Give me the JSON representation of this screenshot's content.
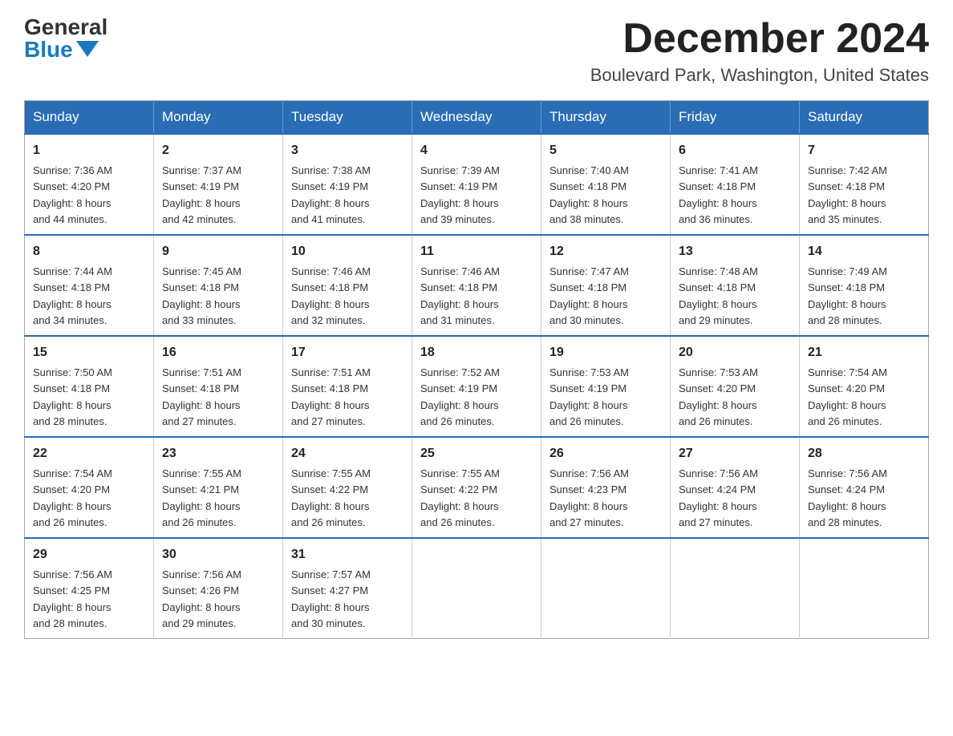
{
  "logo": {
    "general": "General",
    "blue": "Blue"
  },
  "title": "December 2024",
  "subtitle": "Boulevard Park, Washington, United States",
  "days_of_week": [
    "Sunday",
    "Monday",
    "Tuesday",
    "Wednesday",
    "Thursday",
    "Friday",
    "Saturday"
  ],
  "weeks": [
    [
      {
        "day": "1",
        "sunrise": "7:36 AM",
        "sunset": "4:20 PM",
        "daylight": "8 hours and 44 minutes."
      },
      {
        "day": "2",
        "sunrise": "7:37 AM",
        "sunset": "4:19 PM",
        "daylight": "8 hours and 42 minutes."
      },
      {
        "day": "3",
        "sunrise": "7:38 AM",
        "sunset": "4:19 PM",
        "daylight": "8 hours and 41 minutes."
      },
      {
        "day": "4",
        "sunrise": "7:39 AM",
        "sunset": "4:19 PM",
        "daylight": "8 hours and 39 minutes."
      },
      {
        "day": "5",
        "sunrise": "7:40 AM",
        "sunset": "4:18 PM",
        "daylight": "8 hours and 38 minutes."
      },
      {
        "day": "6",
        "sunrise": "7:41 AM",
        "sunset": "4:18 PM",
        "daylight": "8 hours and 36 minutes."
      },
      {
        "day": "7",
        "sunrise": "7:42 AM",
        "sunset": "4:18 PM",
        "daylight": "8 hours and 35 minutes."
      }
    ],
    [
      {
        "day": "8",
        "sunrise": "7:44 AM",
        "sunset": "4:18 PM",
        "daylight": "8 hours and 34 minutes."
      },
      {
        "day": "9",
        "sunrise": "7:45 AM",
        "sunset": "4:18 PM",
        "daylight": "8 hours and 33 minutes."
      },
      {
        "day": "10",
        "sunrise": "7:46 AM",
        "sunset": "4:18 PM",
        "daylight": "8 hours and 32 minutes."
      },
      {
        "day": "11",
        "sunrise": "7:46 AM",
        "sunset": "4:18 PM",
        "daylight": "8 hours and 31 minutes."
      },
      {
        "day": "12",
        "sunrise": "7:47 AM",
        "sunset": "4:18 PM",
        "daylight": "8 hours and 30 minutes."
      },
      {
        "day": "13",
        "sunrise": "7:48 AM",
        "sunset": "4:18 PM",
        "daylight": "8 hours and 29 minutes."
      },
      {
        "day": "14",
        "sunrise": "7:49 AM",
        "sunset": "4:18 PM",
        "daylight": "8 hours and 28 minutes."
      }
    ],
    [
      {
        "day": "15",
        "sunrise": "7:50 AM",
        "sunset": "4:18 PM",
        "daylight": "8 hours and 28 minutes."
      },
      {
        "day": "16",
        "sunrise": "7:51 AM",
        "sunset": "4:18 PM",
        "daylight": "8 hours and 27 minutes."
      },
      {
        "day": "17",
        "sunrise": "7:51 AM",
        "sunset": "4:18 PM",
        "daylight": "8 hours and 27 minutes."
      },
      {
        "day": "18",
        "sunrise": "7:52 AM",
        "sunset": "4:19 PM",
        "daylight": "8 hours and 26 minutes."
      },
      {
        "day": "19",
        "sunrise": "7:53 AM",
        "sunset": "4:19 PM",
        "daylight": "8 hours and 26 minutes."
      },
      {
        "day": "20",
        "sunrise": "7:53 AM",
        "sunset": "4:20 PM",
        "daylight": "8 hours and 26 minutes."
      },
      {
        "day": "21",
        "sunrise": "7:54 AM",
        "sunset": "4:20 PM",
        "daylight": "8 hours and 26 minutes."
      }
    ],
    [
      {
        "day": "22",
        "sunrise": "7:54 AM",
        "sunset": "4:20 PM",
        "daylight": "8 hours and 26 minutes."
      },
      {
        "day": "23",
        "sunrise": "7:55 AM",
        "sunset": "4:21 PM",
        "daylight": "8 hours and 26 minutes."
      },
      {
        "day": "24",
        "sunrise": "7:55 AM",
        "sunset": "4:22 PM",
        "daylight": "8 hours and 26 minutes."
      },
      {
        "day": "25",
        "sunrise": "7:55 AM",
        "sunset": "4:22 PM",
        "daylight": "8 hours and 26 minutes."
      },
      {
        "day": "26",
        "sunrise": "7:56 AM",
        "sunset": "4:23 PM",
        "daylight": "8 hours and 27 minutes."
      },
      {
        "day": "27",
        "sunrise": "7:56 AM",
        "sunset": "4:24 PM",
        "daylight": "8 hours and 27 minutes."
      },
      {
        "day": "28",
        "sunrise": "7:56 AM",
        "sunset": "4:24 PM",
        "daylight": "8 hours and 28 minutes."
      }
    ],
    [
      {
        "day": "29",
        "sunrise": "7:56 AM",
        "sunset": "4:25 PM",
        "daylight": "8 hours and 28 minutes."
      },
      {
        "day": "30",
        "sunrise": "7:56 AM",
        "sunset": "4:26 PM",
        "daylight": "8 hours and 29 minutes."
      },
      {
        "day": "31",
        "sunrise": "7:57 AM",
        "sunset": "4:27 PM",
        "daylight": "8 hours and 30 minutes."
      },
      null,
      null,
      null,
      null
    ]
  ],
  "labels": {
    "sunrise": "Sunrise:",
    "sunset": "Sunset:",
    "daylight": "Daylight:"
  }
}
